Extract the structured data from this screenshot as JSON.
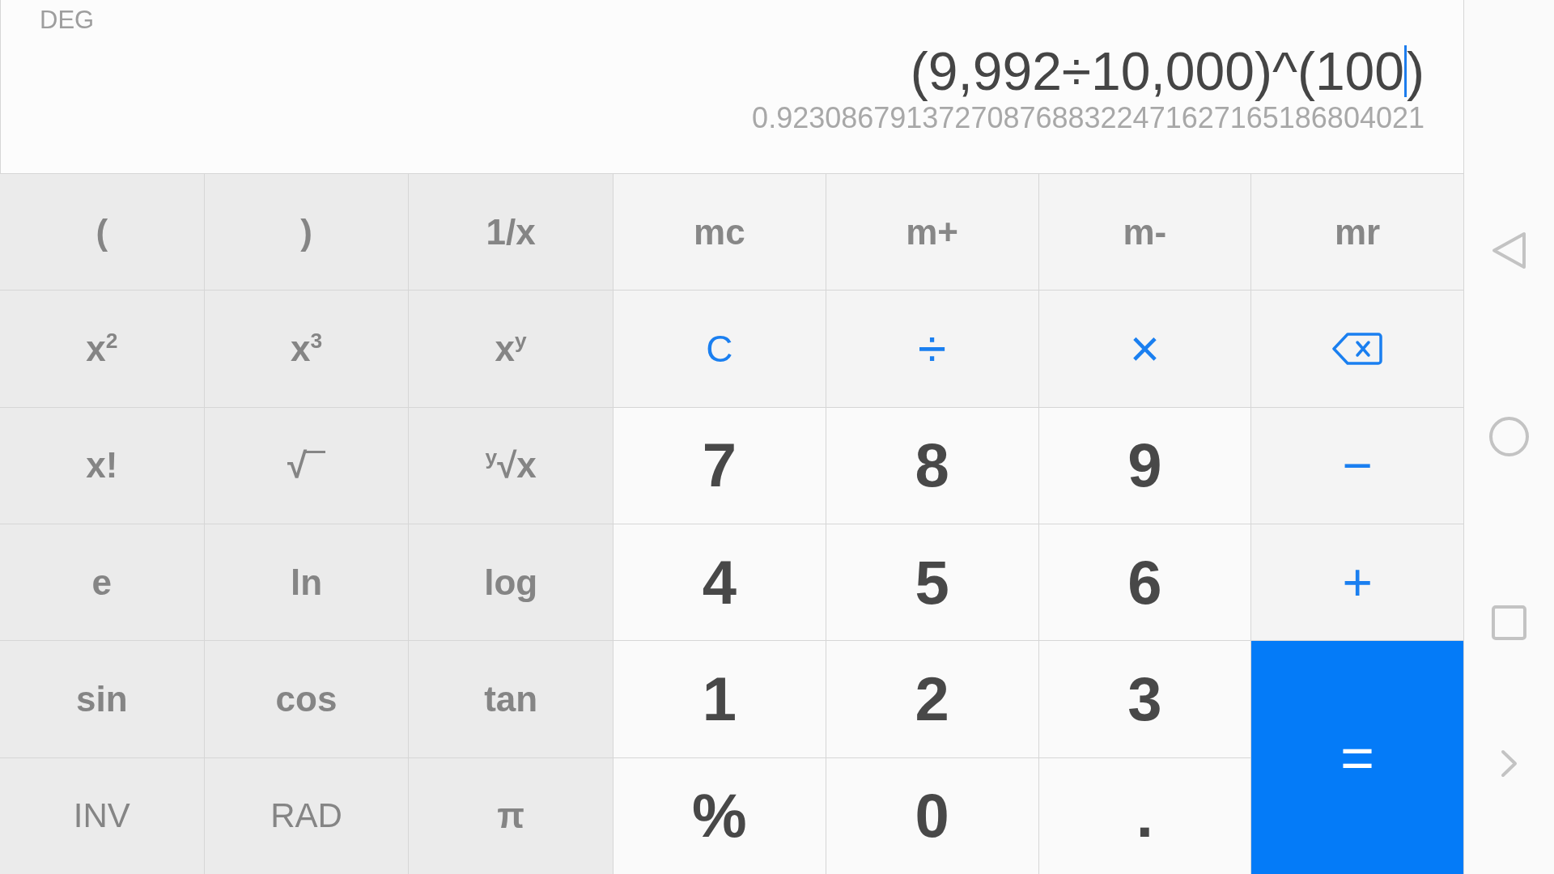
{
  "display": {
    "angle_mode": "DEG",
    "expression": {
      "before_cursor": "(9,992÷10,000)^(100",
      "after_cursor": ")"
    },
    "result": "0.9230867913727087688322471627165186804021"
  },
  "scientific_keys": [
    {
      "label": "(",
      "kind": "function"
    },
    {
      "label": ")",
      "kind": "function"
    },
    {
      "label": "1/x",
      "kind": "function"
    },
    {
      "label": "x$^{2}$",
      "kind": "function"
    },
    {
      "label": "x$^{3}$",
      "kind": "function"
    },
    {
      "label": "x$^{y}$",
      "kind": "function"
    },
    {
      "label": "x!",
      "kind": "function"
    },
    {
      "label": "√",
      "kind": "root"
    },
    {
      "label": "$^{y}$√x",
      "kind": "function"
    },
    {
      "label": "e",
      "kind": "function"
    },
    {
      "label": "ln",
      "kind": "function"
    },
    {
      "label": "log",
      "kind": "function"
    },
    {
      "label": "sin",
      "kind": "function"
    },
    {
      "label": "cos",
      "kind": "function"
    },
    {
      "label": "tan",
      "kind": "function"
    },
    {
      "label": "INV",
      "kind": "mode"
    },
    {
      "label": "RAD",
      "kind": "mode"
    },
    {
      "label": "π",
      "kind": "function"
    }
  ],
  "main_keys": [
    {
      "label": "mc",
      "kind": "memory"
    },
    {
      "label": "m+",
      "kind": "memory"
    },
    {
      "label": "m-",
      "kind": "memory"
    },
    {
      "label": "mr",
      "kind": "memory"
    },
    {
      "label": "C",
      "kind": "clear"
    },
    {
      "label": "÷",
      "kind": "operator"
    },
    {
      "label": "×",
      "kind": "operator"
    },
    {
      "kind": "backspace"
    },
    {
      "label": "7",
      "kind": "digit"
    },
    {
      "label": "8",
      "kind": "digit"
    },
    {
      "label": "9",
      "kind": "digit"
    },
    {
      "label": "−",
      "kind": "operator"
    },
    {
      "label": "4",
      "kind": "digit"
    },
    {
      "label": "5",
      "kind": "digit"
    },
    {
      "label": "6",
      "kind": "digit"
    },
    {
      "label": "+",
      "kind": "operator"
    },
    {
      "label": "1",
      "kind": "digit"
    },
    {
      "label": "2",
      "kind": "digit"
    },
    {
      "label": "3",
      "kind": "digit"
    },
    {
      "label": "=",
      "kind": "equals"
    },
    {
      "label": "%",
      "kind": "digit"
    },
    {
      "label": "0",
      "kind": "digit"
    },
    {
      "label": ".",
      "kind": "digit"
    }
  ]
}
